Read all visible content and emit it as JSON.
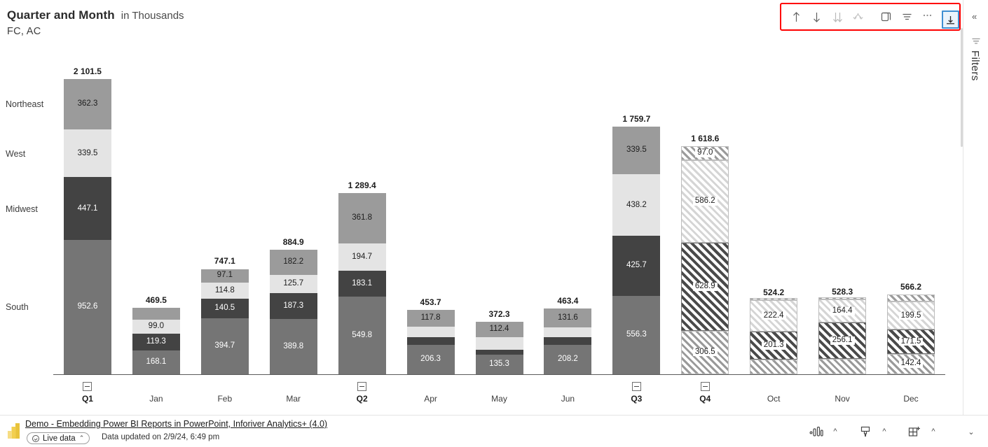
{
  "header": {
    "title": "Quarter and Month",
    "title_suffix": "in Thousands",
    "subtitle": "FC,  AC"
  },
  "toolbar": {
    "buttons": [
      {
        "name": "sort-ascending-icon",
        "label": "Sort ascending"
      },
      {
        "name": "sort-descending-icon",
        "label": "Sort descending"
      },
      {
        "name": "sort-double-down-icon",
        "label": "Sort by"
      },
      {
        "name": "hierarchy-icon",
        "label": "Drill down"
      },
      {
        "name": "copy-icon",
        "label": "Copy visual"
      },
      {
        "name": "filter-icon",
        "label": "Filters"
      },
      {
        "name": "more-options-icon",
        "label": "More options"
      },
      {
        "name": "focus-mode-icon",
        "label": "Focus mode"
      }
    ],
    "highlight_color": "#fe0000",
    "focus_accent": "#3f8fd2"
  },
  "right_rail": {
    "collapse_label": "«",
    "filters_label": "Filters"
  },
  "footer": {
    "report_link": "Demo - Embedding Power BI Reports in PowerPoint, Inforiver Analytics+ (4.0)",
    "live_badge": "Live data",
    "live_caret": "⌃",
    "updated_text": "Data updated on 2/9/24, 6:49 pm",
    "right_buttons": [
      {
        "name": "visualizations-icon",
        "label": "Visualizations"
      },
      {
        "name": "format-brush-icon",
        "label": "Format"
      },
      {
        "name": "add-visual-icon",
        "label": "Add visual"
      },
      {
        "name": "collapse-down-icon",
        "label": "Collapse"
      }
    ]
  },
  "chart_data": {
    "type": "bar",
    "subtype": "stacked-column",
    "title": "Quarter and Month",
    "subtitle": "in Thousands",
    "series_note": "FC,  AC",
    "xlabel": "",
    "ylabel": "in Thousands",
    "ylim": [
      0,
      2101.5
    ],
    "grid": false,
    "legend_position": "left-axis-labels",
    "categories": [
      "Q1",
      "Jan",
      "Feb",
      "Mar",
      "Q2",
      "Apr",
      "May",
      "Jun",
      "Q3",
      "Q4",
      "Oct",
      "Nov",
      "Dec"
    ],
    "category_kinds": [
      "quarter",
      "month",
      "month",
      "month",
      "quarter",
      "month",
      "month",
      "month",
      "quarter",
      "quarter",
      "month",
      "month",
      "month"
    ],
    "category_forecast": [
      false,
      false,
      false,
      false,
      false,
      false,
      false,
      false,
      false,
      true,
      true,
      true,
      true
    ],
    "series": [
      {
        "name": "South",
        "color": "#757575",
        "values": [
          952.6,
          168.1,
          394.7,
          389.8,
          549.8,
          206.3,
          135.3,
          208.2,
          556.3,
          306.5,
          100.5,
          107.8,
          142.4
        ]
      },
      {
        "name": "Midwest",
        "color": "#434343",
        "values": [
          447.1,
          119.3,
          140.5,
          187.3,
          183.1,
          55.8,
          38.1,
          52.4,
          425.7,
          628.9,
          201.3,
          256.1,
          171.5
        ]
      },
      {
        "name": "West",
        "color": "#e4e4e4",
        "values": [
          339.5,
          99.0,
          114.8,
          125.7,
          194.7,
          73.8,
          86.5,
          71.2,
          438.2,
          586.2,
          222.4,
          164.4,
          199.5
        ]
      },
      {
        "name": "Northeast",
        "color": "#9b9b9b",
        "values": [
          362.3,
          83.1,
          97.1,
          182.2,
          361.8,
          117.8,
          112.4,
          131.6,
          339.5,
          97.0,
          17.2,
          16.0,
          52.8
        ]
      }
    ],
    "totals": [
      2101.5,
      469.5,
      747.1,
      884.9,
      1289.4,
      453.7,
      372.3,
      463.4,
      1759.7,
      1618.6,
      524.2,
      528.3,
      566.2
    ],
    "total_labels": [
      "2 101.5",
      "469.5",
      "747.1",
      "884.9",
      "1 289.4",
      "453.7",
      "372.3",
      "463.4",
      "1 759.7",
      "1 618.6",
      "524.2",
      "528.3",
      "566.2"
    ],
    "axis_category_labels": [
      "Northeast",
      "West",
      "Midwest",
      "South"
    ],
    "data_labels": {
      "Q1": {
        "Northeast": "362.3",
        "West": "339.5",
        "Midwest": "447.1",
        "South": "952.6"
      },
      "Jan": {
        "Northeast": "",
        "West": "99.0",
        "Midwest": "119.3",
        "South": "168.1"
      },
      "Feb": {
        "Northeast": "97.1",
        "West": "114.8",
        "Midwest": "140.5",
        "South": "394.7"
      },
      "Mar": {
        "Northeast": "182.2",
        "West": "125.7",
        "Midwest": "187.3",
        "South": "389.8"
      },
      "Q2": {
        "Northeast": "361.8",
        "West": "194.7",
        "Midwest": "183.1",
        "South": "549.8"
      },
      "Apr": {
        "Northeast": "117.8",
        "West": "",
        "Midwest": "",
        "South": "206.3"
      },
      "May": {
        "Northeast": "112.4",
        "West": "",
        "Midwest": "",
        "South": "135.3"
      },
      "Jun": {
        "Northeast": "131.6",
        "West": "",
        "Midwest": "",
        "South": "208.2"
      },
      "Q3": {
        "Northeast": "339.5",
        "West": "438.2",
        "Midwest": "425.7",
        "South": "556.3"
      },
      "Q4": {
        "Northeast": "97.0",
        "West": "586.2",
        "Midwest": "628.9",
        "South": "306.5"
      },
      "Oct": {
        "Northeast": "",
        "West": "222.4",
        "Midwest": "201.3",
        "South": ""
      },
      "Nov": {
        "Northeast": "",
        "West": "164.4",
        "Midwest": "256.1",
        "South": ""
      },
      "Dec": {
        "Northeast": "",
        "West": "199.5",
        "Midwest": "171.5",
        "South": "142.4"
      }
    },
    "collapse_control_categories": [
      "Q1",
      "Q2",
      "Q3",
      "Q4"
    ],
    "collapse_control_symbol": "−"
  }
}
